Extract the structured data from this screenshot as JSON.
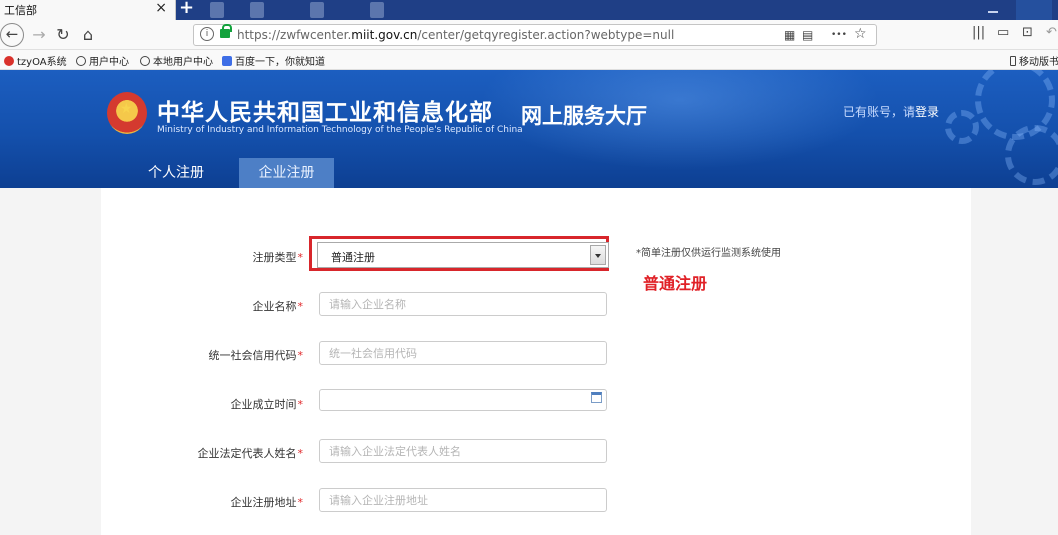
{
  "browser": {
    "tab_title": "工信部",
    "tab_close": "×",
    "new_tab": "+",
    "url_prefix": "https://zwfwcenter.",
    "url_host": "miit.gov.cn",
    "url_path": "/center/getqyregister.action?webtype=null",
    "menu_dots": "•••",
    "star": "☆",
    "icons": [
      "back-arrow-icon",
      "forward-arrow-icon",
      "reload-icon",
      "home-icon",
      "info-icon",
      "lock-icon",
      "qr-icon",
      "reader-icon",
      "library-icon",
      "sidebar-icon",
      "hand-icon"
    ]
  },
  "bookmarks": [
    {
      "label": "tzyOA系统"
    },
    {
      "label": "用户中心"
    },
    {
      "label": "本地用户中心"
    },
    {
      "label": "百度一下，你就知道"
    },
    {
      "label": "移动版书"
    }
  ],
  "header": {
    "ministry_cn": "中华人民共和国工业和信息化部",
    "ministry_en": "Ministry of Industry and Information Technology of the People's Republic of China",
    "hall_title": "网上服务大厅",
    "account_text": "已有账号，请",
    "login_label": "登录",
    "tabs": [
      {
        "label": "个人注册",
        "active": false
      },
      {
        "label": "企业注册",
        "active": true
      }
    ]
  },
  "form": {
    "required_mark": "*",
    "reg_type": {
      "label": "注册类型",
      "value": "普通注册"
    },
    "note": "*简单注册仅供运行监测系统使用",
    "annotation": "普通注册",
    "fields": [
      {
        "label": "企业名称",
        "placeholder": "请输入企业名称"
      },
      {
        "label": "统一社会信用代码",
        "placeholder": "统一社会信用代码"
      },
      {
        "label": "企业成立时间",
        "placeholder": ""
      },
      {
        "label": "企业法定代表人姓名",
        "placeholder": "请输入企业法定代表人姓名"
      },
      {
        "label": "企业注册地址",
        "placeholder": "请输入企业注册地址"
      }
    ]
  },
  "colors": {
    "header_blue": "#1450ac",
    "active_tab": "#4d7fc6",
    "highlight_red": "#d8262b",
    "annotation_red": "#e02127",
    "required_red": "#e0282b"
  }
}
